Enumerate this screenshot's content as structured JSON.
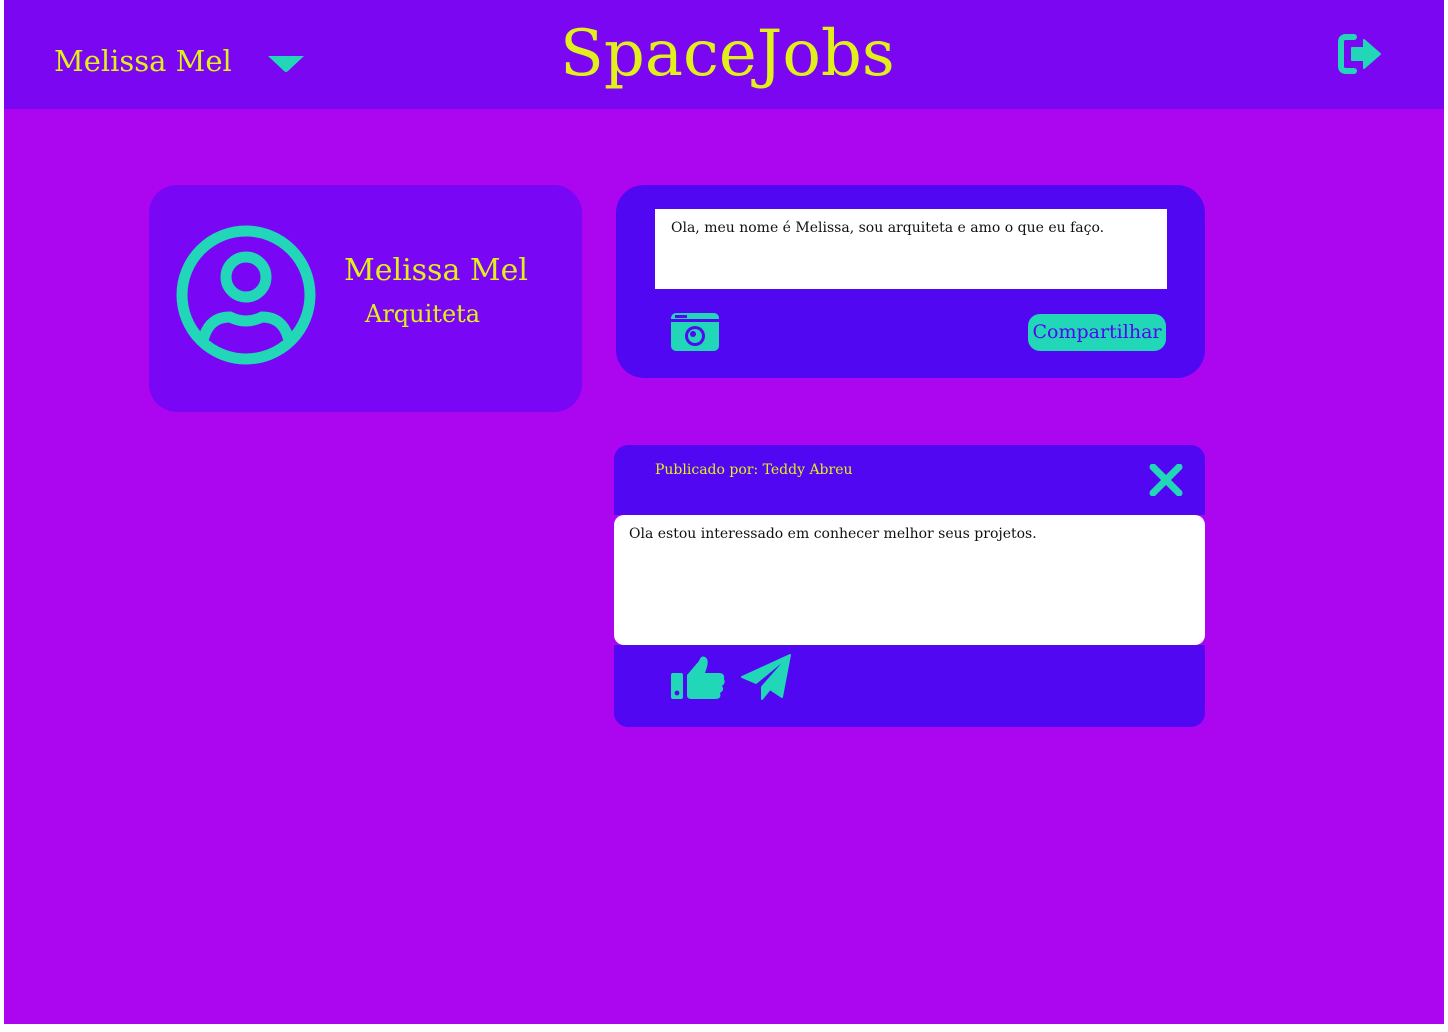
{
  "app": {
    "brand": "SpaceJobs"
  },
  "topbar": {
    "user_name": "Melissa Mel",
    "menu_icon": "chevron-down-icon",
    "logout_icon": "logout-icon"
  },
  "profile": {
    "name": "Melissa Mel",
    "role": "Arquiteta",
    "avatar_icon": "user-circle-icon"
  },
  "composer": {
    "text": "Ola, meu nome é Melissa, sou arquiteta e amo o que eu faço.",
    "attach_icon": "camera-icon",
    "share_label": "Compartilhar"
  },
  "post": {
    "author_label": "Publicado por: Teddy Abreu",
    "close_icon": "close-icon",
    "body": "Ola estou interessado em conhecer melhor seus projetos.",
    "like_icon": "thumbs-up-icon",
    "send_icon": "paper-plane-icon"
  },
  "colors": {
    "background": "#ab06ef",
    "topbar": "#7a06f2",
    "card": "#7906f4",
    "panel": "#5207f2",
    "accent_text": "#e1f01a",
    "icon": "#22d6b8"
  }
}
